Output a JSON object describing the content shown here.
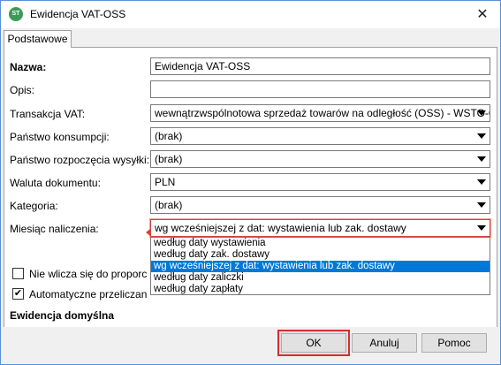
{
  "window": {
    "title": "Ewidencja VAT-OSS",
    "icon": "app-logo-icon",
    "close_symbol": "✕"
  },
  "tabs": [
    {
      "label": "Podstawowe",
      "active": true
    }
  ],
  "form": {
    "nazwa": {
      "label": "Nazwa:",
      "value": "Ewidencja VAT-OSS"
    },
    "opis": {
      "label": "Opis:",
      "value": ""
    },
    "transakcja_vat": {
      "label": "Transakcja VAT:",
      "value": "wewnątrzwspólnotowa sprzedaż towarów na odległość (OSS) - WSTO-OSS"
    },
    "panstwo_konsumpcji": {
      "label": "Państwo konsumpcji:",
      "value": "(brak)"
    },
    "panstwo_rozpoczecia": {
      "label": "Państwo rozpoczęcia wysyłki:",
      "value": "(brak)"
    },
    "waluta": {
      "label": "Waluta dokumentu:",
      "value": "PLN"
    },
    "kategoria": {
      "label": "Kategoria:",
      "value": "(brak)"
    },
    "miesiac_naliczenia": {
      "label": "Miesiąc naliczenia:",
      "value": "wg wcześniejszej z dat: wystawienia lub zak. dostawy",
      "options": [
        "według daty wystawienia",
        "według daty zak. dostawy",
        "wg wcześniejszej z dat: wystawienia lub zak. dostawy",
        "według daty zaliczki",
        "według daty zapłaty"
      ],
      "selected_index": 2
    },
    "checkbox_proporcji": {
      "label": "Nie wlicza się do proporcji ba",
      "checked": false
    },
    "checkbox_przeliczanie": {
      "label": "Automatyczne przeliczanie kw",
      "checked": true,
      "check_symbol": "✔"
    },
    "section_ewidencja_domyslna": "Ewidencja domyślna"
  },
  "buttons": {
    "ok": "OK",
    "anuluj": "Anuluj",
    "pomoc": "Pomoc"
  },
  "colors": {
    "highlight": "#d32f2f",
    "selection": "#0078d7"
  }
}
